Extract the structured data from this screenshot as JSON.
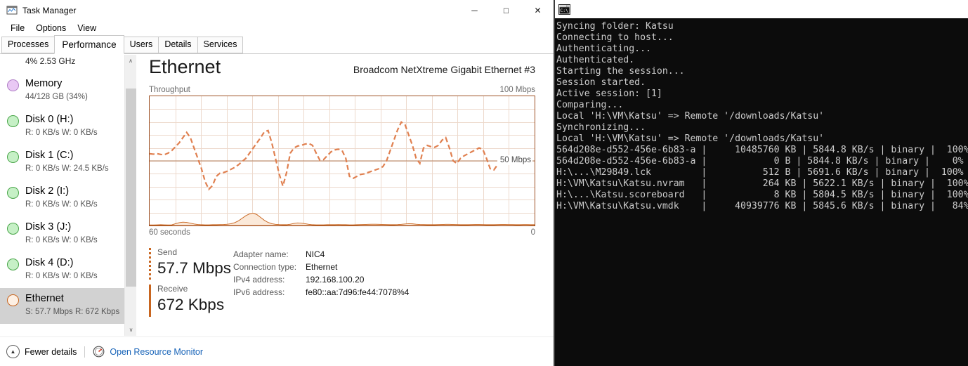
{
  "taskmanager": {
    "title": "Task Manager",
    "title_icon": "task-manager-icon",
    "window_buttons": {
      "minimize": "─",
      "maximize": "□",
      "close": "✕"
    },
    "menus": [
      "File",
      "Options",
      "View"
    ],
    "tabs": [
      {
        "label": "Processes",
        "active": false
      },
      {
        "label": "Performance",
        "active": true
      },
      {
        "label": "Users",
        "active": false
      },
      {
        "label": "Details",
        "active": false
      },
      {
        "label": "Services",
        "active": false
      }
    ],
    "sidebar": {
      "items": [
        {
          "name": "",
          "sub": "4% 2.53 GHz",
          "dot": "#b56fd4",
          "partial": true,
          "selected": false
        },
        {
          "name": "Memory",
          "sub": "44/128 GB (34%)",
          "dot": "#d9a9e8",
          "partial": false,
          "selected": false
        },
        {
          "name": "Disk 0 (H:)",
          "sub": "R: 0 KB/s  W: 0 KB/s",
          "dot": "#8fe08f",
          "partial": false,
          "selected": false
        },
        {
          "name": "Disk 1 (C:)",
          "sub": "R: 0 KB/s  W: 24.5 KB/s",
          "dot": "#8fe08f",
          "partial": false,
          "selected": false
        },
        {
          "name": "Disk 2 (I:)",
          "sub": "R: 0 KB/s  W: 0 KB/s",
          "dot": "#8fe08f",
          "partial": false,
          "selected": false
        },
        {
          "name": "Disk 3 (J:)",
          "sub": "R: 0 KB/s  W: 0 KB/s",
          "dot": "#8fe08f",
          "partial": false,
          "selected": false
        },
        {
          "name": "Disk 4 (D:)",
          "sub": "R: 0 KB/s  W: 0 KB/s",
          "dot": "#8fe08f",
          "partial": false,
          "selected": false
        },
        {
          "name": "Ethernet",
          "sub": "S: 57.7 Mbps  R: 672 Kbps",
          "dot": "#fdf0e4",
          "partial": false,
          "selected": true
        }
      ],
      "scroll_up": "∧",
      "scroll_down": "∨"
    },
    "main": {
      "title": "Ethernet",
      "adapter_caption": "Broadcom NetXtreme Gigabit Ethernet #3",
      "graph_label_left": "Throughput",
      "graph_label_right": "100 Mbps",
      "graph_mid_label": "50 Mbps",
      "graph_foot_left": "60 seconds",
      "graph_foot_right": "0",
      "send": {
        "label": "Send",
        "value": "57.7 Mbps"
      },
      "receive": {
        "label": "Receive",
        "value": "672 Kbps"
      },
      "info": [
        {
          "key": "Adapter name:",
          "value": "NIC4"
        },
        {
          "key": "Connection type:",
          "value": "Ethernet"
        },
        {
          "key": "IPv4 address:",
          "value": "192.168.100.20"
        },
        {
          "key": "IPv6 address:",
          "value": "fe80::aa:7d96:fe44:7078%4"
        }
      ]
    },
    "statusbar": {
      "fewer_details": "Fewer details",
      "chevron_icon": "chevron-up-icon",
      "resource_monitor_icon": "resource-monitor-icon",
      "resource_monitor": "Open Resource Monitor"
    },
    "colors": {
      "accent": "#c8651f",
      "graph_border": "#9e5125",
      "graph_grid": "#edd9cc",
      "link": "#1763b8",
      "selected_row": "#d2d2d2"
    }
  },
  "chart_data": {
    "type": "line",
    "title": "Throughput",
    "xlabel": "60 seconds",
    "ylabel": "Mbps",
    "ylim": [
      0,
      100
    ],
    "xlim": [
      60,
      0
    ],
    "grid": true,
    "reference_lines": [
      {
        "value": 50,
        "label": "50 Mbps"
      }
    ],
    "legend": "none",
    "series": [
      {
        "name": "Send",
        "color": "#e08050",
        "style": "dashed",
        "values": [
          55.5,
          55.2,
          55.6,
          55.0,
          54.8,
          56.0,
          58.0,
          61.0,
          64.0,
          68.0,
          72.0,
          68.0,
          60.0,
          52.0,
          44.0,
          34.0,
          28.0,
          31.0,
          38.0,
          40.5,
          41.0,
          42.0,
          43.5,
          45.0,
          47.0,
          49.5,
          52.0,
          56.0,
          60.0,
          64.0,
          68.0,
          72.5,
          73.5,
          64.0,
          52.0,
          40.0,
          30.5,
          41.0,
          56.0,
          60.0,
          61.5,
          62.0,
          63.0,
          63.5,
          62.0,
          56.0,
          50.5,
          51.0,
          54.0,
          57.0,
          58.5,
          59.0,
          58.0,
          52.0,
          38.0,
          36.5,
          38.0,
          39.5,
          40.0,
          41.0,
          42.0,
          43.0,
          44.0,
          45.5,
          50.0,
          58.0,
          66.0,
          74.0,
          80.0,
          78.0,
          70.0,
          62.0,
          52.0,
          48.0,
          60.0,
          62.0,
          61.0,
          60.5,
          62.0,
          66.0,
          68.0,
          60.0,
          50.0,
          48.0,
          52.0,
          54.0,
          55.5,
          57.0,
          58.5,
          60.0,
          59.0,
          52.0,
          44.0,
          43.0,
          47.0,
          50.0,
          51.0,
          52.0,
          52.5,
          52.0,
          52.5,
          53.0,
          52.5,
          53.5,
          54.0
        ]
      },
      {
        "name": "Receive",
        "color": "#c8651f",
        "style": "area",
        "values": [
          0.4,
          0.4,
          0.5,
          0.6,
          0.5,
          0.4,
          0.5,
          1.4,
          2.2,
          2.6,
          2.4,
          1.8,
          1.2,
          0.8,
          0.6,
          0.5,
          0.5,
          0.6,
          0.6,
          0.7,
          0.8,
          1.0,
          1.4,
          2.2,
          3.6,
          5.6,
          7.6,
          9.0,
          9.6,
          8.4,
          6.2,
          4.0,
          2.4,
          1.4,
          0.9,
          0.7,
          0.6,
          0.6,
          1.0,
          1.6,
          2.0,
          1.8,
          1.4,
          0.9,
          0.6,
          0.5,
          0.5,
          0.5,
          0.6,
          0.6,
          0.6,
          0.7,
          0.6,
          0.6,
          0.5,
          0.5,
          0.6,
          0.7,
          0.8,
          0.9,
          1.0,
          1.0,
          0.9,
          0.8,
          0.7,
          0.6,
          0.6,
          0.7,
          0.9,
          1.2,
          1.4,
          1.3,
          1.0,
          0.8,
          0.7,
          0.6,
          0.6,
          0.6,
          0.7,
          0.8,
          0.9,
          0.9,
          0.8,
          0.7,
          0.6,
          0.6,
          0.6,
          0.7,
          0.8,
          0.8,
          0.7,
          0.6,
          0.6,
          0.6,
          0.7,
          0.8,
          0.8,
          0.7,
          0.7,
          0.6,
          0.6,
          0.7,
          0.7,
          0.6,
          0.6
        ]
      }
    ]
  },
  "console": {
    "icon": "cmd-icon",
    "title": "",
    "lines": [
      "Syncing folder: Katsu",
      "Connecting to host...",
      "Authenticating...",
      "Authenticated.",
      "Starting the session...",
      "Session started.",
      "Active session: [1]",
      "Comparing...",
      "Local 'H:\\VM\\Katsu' => Remote '/downloads/Katsu'",
      "Synchronizing...",
      "Local 'H:\\VM\\Katsu' => Remote '/downloads/Katsu'",
      "564d208e-d552-456e-6b83-a |     10485760 KB | 5844.8 KB/s | binary |  100%",
      "564d208e-d552-456e-6b83-a |            0 B | 5844.8 KB/s | binary |    0%",
      "H:\\...\\M29849.lck         |          512 B | 5691.6 KB/s | binary |  100%",
      "H:\\VM\\Katsu\\Katsu.nvram   |          264 KB | 5622.1 KB/s | binary |  100%",
      "H:\\...\\Katsu.scoreboard   |            8 KB | 5804.5 KB/s | binary |  100%",
      "H:\\VM\\Katsu\\Katsu.vmdk    |     40939776 KB | 5845.6 KB/s | binary |   84%"
    ]
  }
}
